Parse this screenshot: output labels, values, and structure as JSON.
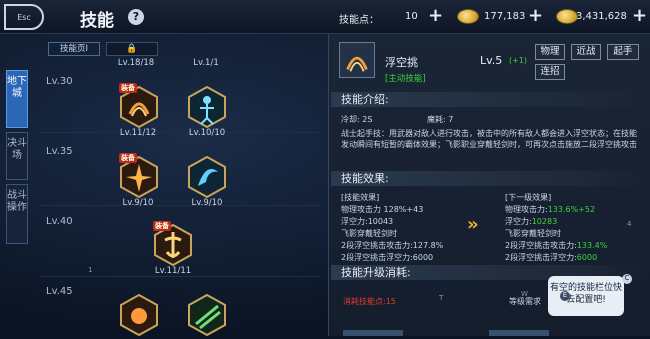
{
  "topbar": {
    "esc_label": "Esc",
    "title": "技能",
    "help_icon": "question-icon",
    "skill_points_label": "技能点：",
    "skill_points": "10",
    "gold": "177,183",
    "currency2": "3,431,628"
  },
  "side_tabs": [
    "地下城",
    "决斗场",
    "战斗操作"
  ],
  "tree": {
    "page_tab": "技能页Ⅰ",
    "locked_tab_icon": "lock-icon",
    "rows": [
      "Lv.30",
      "Lv.35",
      "Lv.40",
      "Lv.45"
    ],
    "equip_label": "装备",
    "skills": [
      {
        "name": "",
        "level": "Lv.18/18"
      },
      {
        "name": "",
        "level": "Lv.1/1"
      },
      {
        "name": "",
        "level": "Lv.11/12",
        "equipped": true
      },
      {
        "name": "",
        "level": "Lv.10/10"
      },
      {
        "name": "",
        "level": "Lv.9/10",
        "equipped": true
      },
      {
        "name": "",
        "level": "Lv.9/10"
      },
      {
        "name": "",
        "level": "Lv.11/11",
        "equipped": true
      },
      {
        "name": "",
        "level": ""
      },
      {
        "name": "",
        "level": ""
      }
    ],
    "marker_1": "1"
  },
  "detail": {
    "skill_name": "浮空挑",
    "skill_type": "[主动技能]",
    "level": "Lv.5",
    "level_bonus": "(+1)",
    "tags": [
      "物理",
      "近战",
      "起手",
      "连招"
    ],
    "intro_header": "技能介绍:",
    "cooldown": "冷却: 2S",
    "mana": "魔耗: 7",
    "description": "战士起手技：用武器对敌人进行攻击，被击中的所有敌人都会进入浮空状态；在技能发动瞬间有短暂的霸体效果；飞影职业穿戴轻剑时，可再次点击施放二段浮空挑攻击",
    "effect_header": "技能效果:",
    "current_title": "[技能效果]",
    "current_lines": [
      "物理攻击力 128%+43",
      "浮空力:10043",
      "飞影穿戴轻剑时",
      "2段浮空挑击攻击力:127.8%",
      "2段浮空挑击浮空力:6000"
    ],
    "next_title": "[下一级效果]",
    "next_lines": [
      {
        "label": "物理攻击力:",
        "value": "133.6%+52"
      },
      {
        "label": "浮空力:",
        "value": "10283"
      },
      {
        "label": "飞影穿戴轻剑时",
        "value": ""
      },
      {
        "label": "2段浮空挑击攻击力:",
        "value": "133.4%"
      },
      {
        "label": "2段浮空挑击浮空力:",
        "value": "6000"
      }
    ],
    "marker_4": "4",
    "upgrade_header": "技能升级消耗:",
    "cost_label": "消耗技能点:15",
    "marker_t": "T",
    "marker_w": "W",
    "level_req": "等级需求",
    "tip": "有空的技能栏位快去配置吧!",
    "tip_marker_c": "C",
    "tip_marker_e": "E"
  }
}
